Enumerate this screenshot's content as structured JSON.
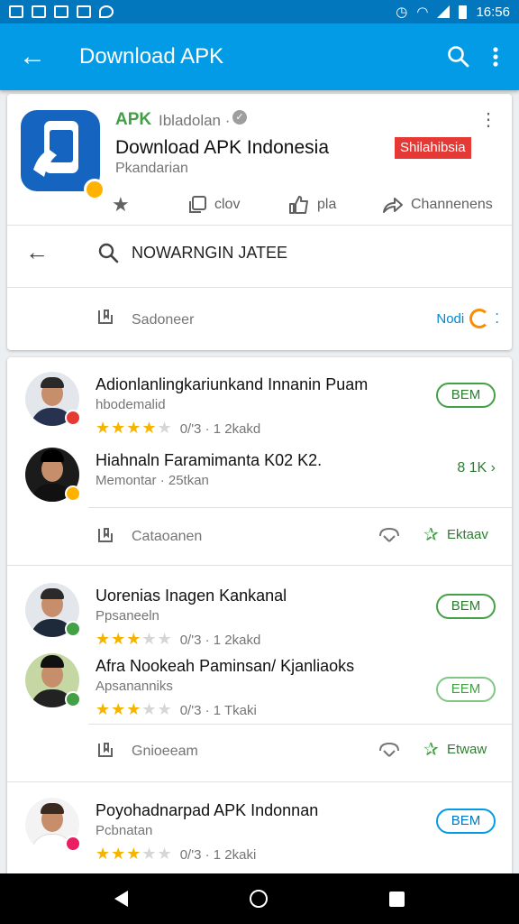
{
  "status_bar": {
    "time": "16:56"
  },
  "app_bar": {
    "back_glyph": "←",
    "title": "Download APK",
    "icons": [
      "search-icon",
      "more-vert-icon"
    ]
  },
  "top_card": {
    "badge": "APK",
    "sub": "Ibladolan ·",
    "title": "Download APK Indonesia",
    "developer": "Pkandarian",
    "region": "Shilahibsia",
    "actions": [
      {
        "icon": "star-icon",
        "label": ""
      },
      {
        "icon": "copy-icon",
        "label": "clov"
      },
      {
        "icon": "thumb-up-icon",
        "label": "pla"
      },
      {
        "icon": "share-icon",
        "label": "Channenens"
      }
    ],
    "search_text": "NOWARNGIN JATEE",
    "save_label": "Sadoneer",
    "save_right": "Nodi"
  },
  "list": {
    "items": [
      {
        "title": "Adionlanlingkariunkand Innanin Puam",
        "subtitle": "hbodemalid",
        "stars": "★★★★",
        "stars_off": "★",
        "rating": "0/'3 · 1 2kakd",
        "pill": "BEM"
      },
      {
        "title": "Hiahnaln Faramimanta K02 K2.",
        "subtitle": "Memontar · 25tkan",
        "stars": "",
        "stars_off": "",
        "rating": "",
        "count": "8 1K ›"
      },
      {
        "title": "Uorenias Inagen Kankanal",
        "subtitle": "Ppsaneeln",
        "stars": "★★★",
        "stars_off": "★★",
        "rating": "0/'3 · 1 2kakd",
        "pill": "BEM"
      },
      {
        "title": "Afra Nookeah Paminsan/ Kjanliaoks",
        "subtitle": "Apsananniks",
        "stars": "★★★",
        "stars_off": "★★",
        "rating": "0/'3 · 1 Tkaki",
        "pill": "EEM"
      },
      {
        "title": "Poyohadnarpad APK Indonnan",
        "subtitle": "Pcbnatan",
        "stars": "★★★",
        "stars_off": "★★",
        "rating": "0/'3 · 1 2kaki",
        "pill": "BEM"
      }
    ],
    "footers": [
      {
        "label": "Cataoanen",
        "right": "Ektaav"
      },
      {
        "label": "Gnioeeam",
        "right": "Etwaw"
      }
    ],
    "badge_colors": [
      "#e53935",
      "#ffb300",
      "#43a047",
      "#43a047",
      "#e91e63"
    ]
  },
  "nav_bar": {
    "icons": [
      "back-icon",
      "home-icon",
      "recents-icon"
    ]
  }
}
